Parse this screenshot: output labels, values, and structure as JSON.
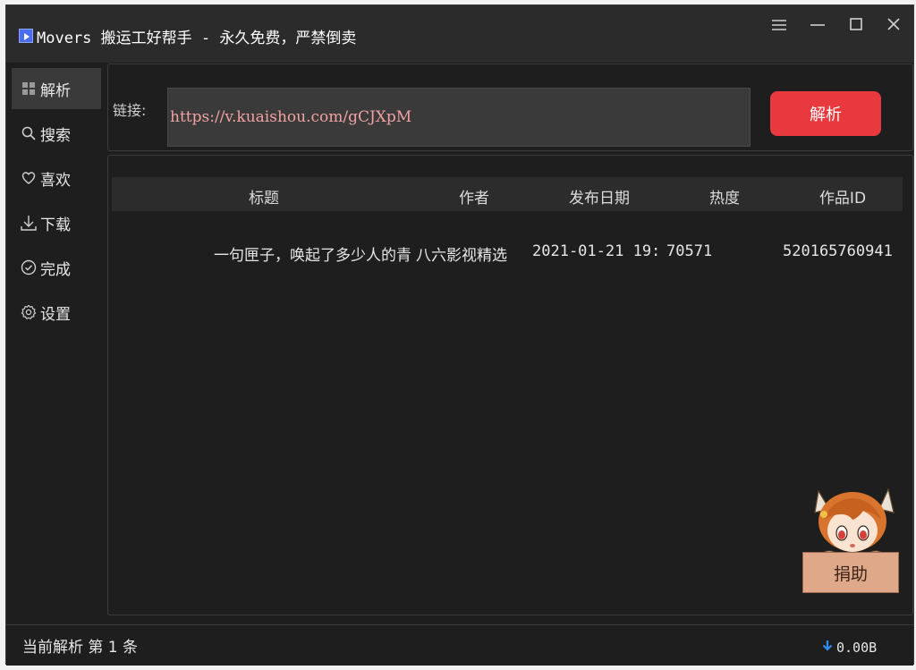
{
  "window": {
    "title": "Movers 搬运工好帮手 - 永久免费，严禁倒卖"
  },
  "sidebar": {
    "items": [
      {
        "label": "解析",
        "icon": "grid-icon"
      },
      {
        "label": "搜索",
        "icon": "search-icon"
      },
      {
        "label": "喜欢",
        "icon": "heart-icon"
      },
      {
        "label": "下载",
        "icon": "download-icon"
      },
      {
        "label": "完成",
        "icon": "check-circle-icon"
      },
      {
        "label": "设置",
        "icon": "gear-icon"
      }
    ],
    "active_index": 0
  },
  "url_panel": {
    "label": "链接:",
    "value": "https://v.kuaishou.com/gCJXpM",
    "button": "解析"
  },
  "table": {
    "columns": [
      "标题",
      "作者",
      "发布日期",
      "热度",
      "作品ID"
    ],
    "rows": [
      {
        "title": "一句匣子，唤起了多少人的青",
        "author": "八六影视精选",
        "date": "2021-01-21 19:",
        "heat": "70571",
        "id": "520165760941"
      }
    ]
  },
  "mascot": {
    "label": "捐助"
  },
  "status": {
    "text": "当前解析 第 1 条",
    "download_speed": "0.00B"
  },
  "colors": {
    "accent": "#e8393e",
    "background": "#1e1e1e",
    "input_bg": "#3a3a3a",
    "url_text": "#f2a2a2",
    "download_arrow": "#2f8cff"
  }
}
